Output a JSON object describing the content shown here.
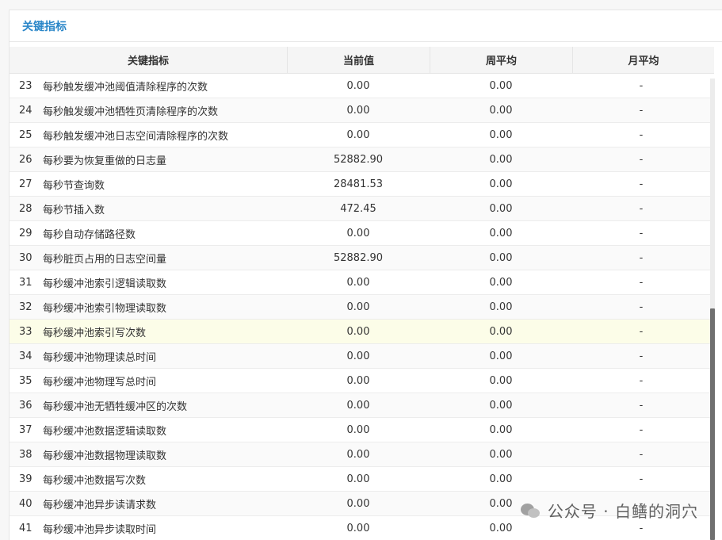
{
  "panel": {
    "title": "关键指标"
  },
  "table": {
    "headers": [
      "关键指标",
      "当前值",
      "周平均",
      "月平均"
    ],
    "rows": [
      {
        "idx": "23",
        "name": "每秒触发缓冲池阈值清除程序的次数",
        "current": "0.00",
        "week": "0.00",
        "month": "-"
      },
      {
        "idx": "24",
        "name": "每秒触发缓冲池牺牲页清除程序的次数",
        "current": "0.00",
        "week": "0.00",
        "month": "-"
      },
      {
        "idx": "25",
        "name": "每秒触发缓冲池日志空间清除程序的次数",
        "current": "0.00",
        "week": "0.00",
        "month": "-"
      },
      {
        "idx": "26",
        "name": "每秒要为恢复重做的日志量",
        "current": "52882.90",
        "week": "0.00",
        "month": "-"
      },
      {
        "idx": "27",
        "name": "每秒节查询数",
        "current": "28481.53",
        "week": "0.00",
        "month": "-"
      },
      {
        "idx": "28",
        "name": "每秒节插入数",
        "current": "472.45",
        "week": "0.00",
        "month": "-"
      },
      {
        "idx": "29",
        "name": "每秒自动存储路径数",
        "current": "0.00",
        "week": "0.00",
        "month": "-"
      },
      {
        "idx": "30",
        "name": "每秒脏页占用的日志空间量",
        "current": "52882.90",
        "week": "0.00",
        "month": "-"
      },
      {
        "idx": "31",
        "name": "每秒缓冲池索引逻辑读取数",
        "current": "0.00",
        "week": "0.00",
        "month": "-"
      },
      {
        "idx": "32",
        "name": "每秒缓冲池索引物理读取数",
        "current": "0.00",
        "week": "0.00",
        "month": "-"
      },
      {
        "idx": "33",
        "name": "每秒缓冲池索引写次数",
        "current": "0.00",
        "week": "0.00",
        "month": "-"
      },
      {
        "idx": "34",
        "name": "每秒缓冲池物理读总时间",
        "current": "0.00",
        "week": "0.00",
        "month": "-"
      },
      {
        "idx": "35",
        "name": "每秒缓冲池物理写总时间",
        "current": "0.00",
        "week": "0.00",
        "month": "-"
      },
      {
        "idx": "36",
        "name": "每秒缓冲池无牺牲缓冲区的次数",
        "current": "0.00",
        "week": "0.00",
        "month": "-"
      },
      {
        "idx": "37",
        "name": "每秒缓冲池数据逻辑读取数",
        "current": "0.00",
        "week": "0.00",
        "month": "-"
      },
      {
        "idx": "38",
        "name": "每秒缓冲池数据物理读取数",
        "current": "0.00",
        "week": "0.00",
        "month": "-"
      },
      {
        "idx": "39",
        "name": "每秒缓冲池数据写次数",
        "current": "0.00",
        "week": "0.00",
        "month": "-"
      },
      {
        "idx": "40",
        "name": "每秒缓冲池异步读请求数",
        "current": "0.00",
        "week": "0.00",
        "month": "-"
      },
      {
        "idx": "41",
        "name": "每秒缓冲池异步读取时间",
        "current": "0.00",
        "week": "0.00",
        "month": "-"
      }
    ],
    "highlighted_row_idx": "33"
  },
  "watermark": {
    "text": "公众号 · 白鳝的洞穴",
    "icon": "wechat-icon"
  }
}
